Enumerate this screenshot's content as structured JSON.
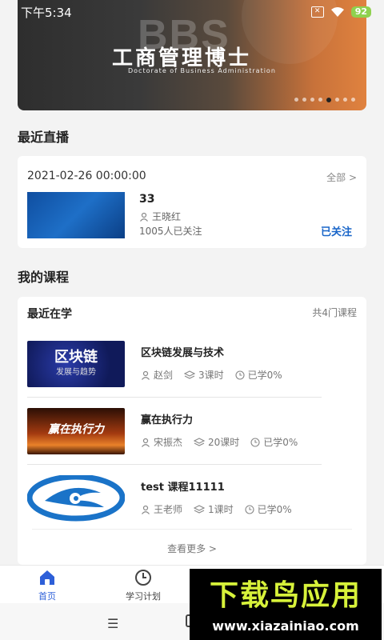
{
  "status_bar": {
    "time": "下午5:34",
    "battery": "92"
  },
  "banner": {
    "big_text": "BBS",
    "title": "工商管理博士",
    "subtitle": "Doctorate of Business Administration",
    "dot_count": 8,
    "active_dot": 5
  },
  "live": {
    "section_title": "最近直播",
    "date": "2021-02-26 00:00:00",
    "all_label": "全部 >",
    "name": "33",
    "teacher": "王晓红",
    "fans": "1005人已关注",
    "follow_label": "已关注"
  },
  "courses": {
    "section_title": "我的课程",
    "recent_label": "最近在学",
    "count_label": "共4门课程",
    "items": [
      {
        "name": "区块链发展与技术",
        "teacher": "赵剑",
        "lessons": "3课时",
        "progress": "已学0%",
        "thumb_title": "区块链",
        "thumb_sub": "发展与趋势"
      },
      {
        "name": "赢在执行力",
        "teacher": "宋振杰",
        "lessons": "20课时",
        "progress": "已学0%",
        "thumb_title": "赢在执行力"
      },
      {
        "name": "test 课程11111",
        "teacher": "王老师",
        "lessons": "1课时",
        "progress": "已学0%"
      }
    ],
    "more_label": "查看更多 >"
  },
  "tabbar": {
    "home": "首页",
    "plan": "学习计划"
  },
  "watermark": {
    "title": "下载鸟应用",
    "url": "www.xiazainiao.com"
  },
  "colors": {
    "accent": "#2d5fd8",
    "follow": "#1a66c9",
    "watermark_green": "#d7f23a"
  }
}
